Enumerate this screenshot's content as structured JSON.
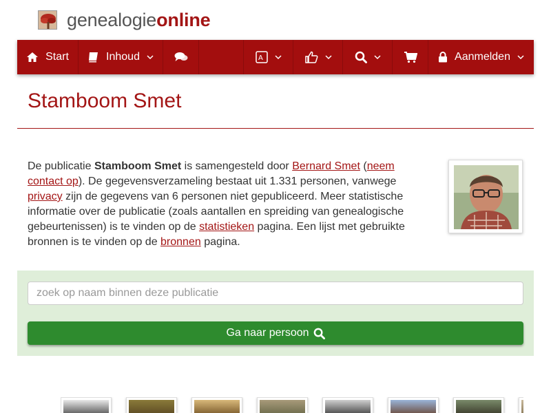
{
  "logo": {
    "text_plain": "genealogie",
    "text_bold": "online",
    "icon": "tree-icon"
  },
  "nav": {
    "start": {
      "label": "Start",
      "icon": "home-icon"
    },
    "inhoud": {
      "label": "Inhoud",
      "icon": "book-icon"
    },
    "comments": {
      "icon": "comments-icon"
    },
    "language": {
      "icon": "language-icon"
    },
    "like": {
      "icon": "thumbs-up-icon"
    },
    "search": {
      "icon": "search-icon"
    },
    "cart": {
      "icon": "cart-icon"
    },
    "login": {
      "label": "Aanmelden",
      "icon": "lock-icon"
    }
  },
  "page": {
    "title": "Stamboom Smet"
  },
  "intro": {
    "t1": "De publicatie ",
    "pub_name": "Stamboom Smet",
    "t2": " is samengesteld door ",
    "author": "Bernard Smet",
    "t3": " (",
    "contact": "neem contact op",
    "t4": "). De gegevensverzameling bestaat uit 1.331 personen, vanwege ",
    "privacy": "privacy",
    "t5": " zijn de gegevens van 6 personen niet gepubliceerd. Meer statistische informatie over de publicatie (zoals aantallen en spreiding van genealogische gebeurtenissen) is te vinden op de ",
    "stats": "statistieken",
    "t6": " pagina. Een lijst met gebruikte bronnen is te vinden op de ",
    "sources": "bronnen",
    "t7": " pagina."
  },
  "search": {
    "placeholder": "zoek op naam binnen deze publicatie",
    "button_label": "Ga naar persoon"
  },
  "colors": {
    "brand": "#a30e0e",
    "title": "#a31515",
    "panel": "#dfeed9",
    "button": "#2e8b2e"
  }
}
